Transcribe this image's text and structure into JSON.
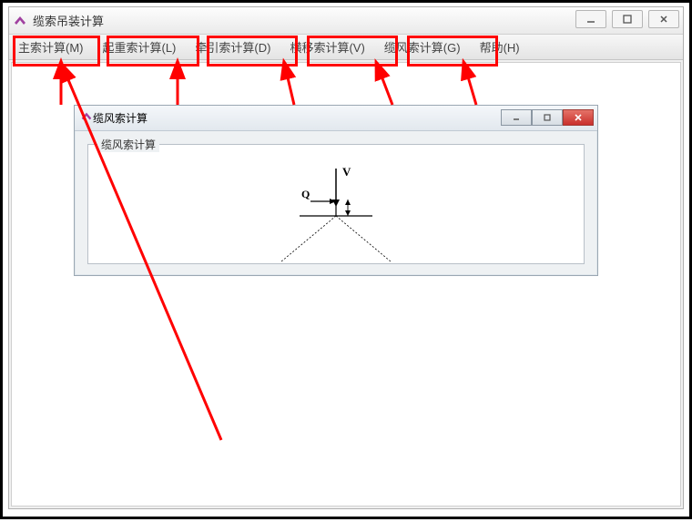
{
  "main_window": {
    "title": "缆索吊装计算"
  },
  "menu": {
    "items": [
      {
        "label": "主索计算(M)"
      },
      {
        "label": "起重索计算(L)"
      },
      {
        "label": "牵引索计算(D)"
      },
      {
        "label": "横移索计算(V)"
      },
      {
        "label": "缆风索计算(G)"
      },
      {
        "label": "帮助(H)"
      }
    ]
  },
  "child_window": {
    "title": "缆风索计算",
    "group_label": "缆风索计算"
  },
  "diagram_labels": {
    "v": "V",
    "q": "Q"
  }
}
